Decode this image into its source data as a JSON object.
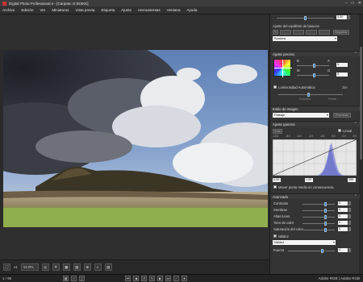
{
  "window": {
    "title": "Digital Photo Professional 4 - [Carpeta: G:\\DSKK]"
  },
  "menu": [
    "Archivo",
    "Edición",
    "Ver",
    "Miniaturas",
    "Vista previa",
    "Etiqueta",
    "Ajuste",
    "Herramientas",
    "Ventana",
    "Ayuda"
  ],
  "panel": {
    "top_value": "0.00",
    "white_balance": {
      "label": "Ajuste del equilibrio de blancos",
      "register_btn": "Registrar",
      "preset": "Sombra"
    },
    "fine_adjust": {
      "header": "Ajuste preciso",
      "labels": {
        "b": "B",
        "m": "M",
        "a": "A",
        "g": "G"
      },
      "values": {
        "b": "0",
        "m": "0"
      },
      "auto_brightness": "Luminosidad Automática",
      "auto_value": "2ite",
      "slider_marks": [
        "Estándar",
        "Fuerte"
      ]
    },
    "picture_style": {
      "header": "Estilo de imagen",
      "value": "Paisaje",
      "examine_btn": "Examinar"
    },
    "tone_curve": {
      "header": "Ajuste gamma",
      "auto_btn": "Auto",
      "linear_label": "Lineal",
      "scale": [
        "-10.0",
        "-8.0",
        "-6.0",
        "-4.0",
        "-2.0",
        "0.0",
        "2.0",
        "4.0"
      ],
      "input_left": "0.00",
      "input_mid": "1.00",
      "input_right": "255",
      "move_midpoint": "Mover punto medio en consecuencia"
    },
    "advanced": {
      "header": "Avanzado",
      "rows": [
        {
          "label": "Contraste",
          "value": "0",
          "level": 0.72
        },
        {
          "label": "Sombras",
          "value": "0",
          "level": 0.72
        },
        {
          "label": "Altas luces",
          "value": "0",
          "level": 0.72
        },
        {
          "label": "Tono de color",
          "value": "0",
          "level": 0.72
        },
        {
          "label": "Saturación del color",
          "value": "0",
          "level": 0.72
        }
      ],
      "sharpness_check": "Nitidez",
      "sharpness_mode": "Nitidez",
      "strength_label": "Fuerza",
      "strength_value": "0",
      "strength_level": 0.75
    }
  },
  "toolbar": {
    "zoom": "12.0%",
    "zoom_value_display": "x1"
  },
  "status": {
    "count": "1 / 95",
    "profile": "Adobe RGB | Adobe RGB"
  },
  "colors": {
    "panel_bg": "#343434",
    "knob": "#2c6fd6",
    "app_bg": "#2b2b2b"
  }
}
